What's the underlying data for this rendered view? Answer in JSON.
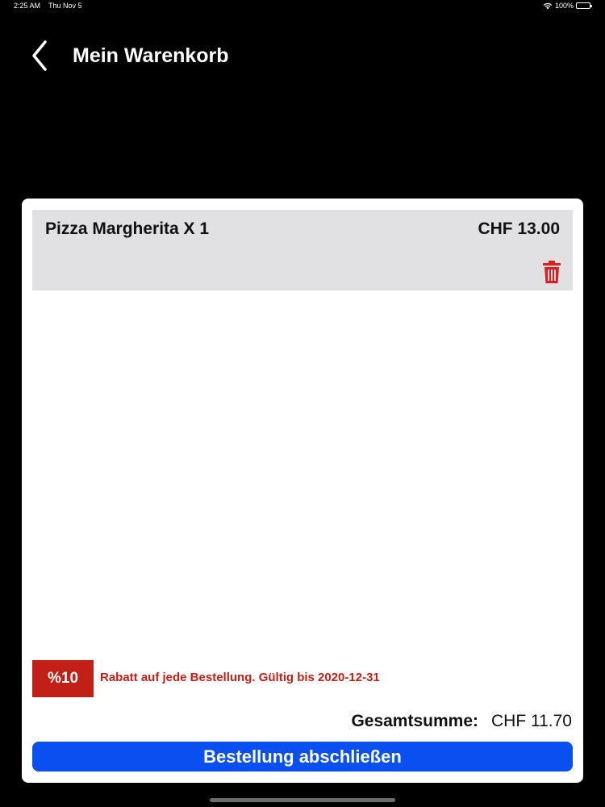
{
  "status_bar": {
    "time": "2:25 AM",
    "date": "Thu Nov 5",
    "battery": "100%"
  },
  "nav": {
    "title": "Mein Warenkorb",
    "back_icon": "chevron-left-icon"
  },
  "cart": {
    "items": [
      {
        "name": "Pizza Margherita X 1",
        "price": "CHF 13.00",
        "delete_icon": "trash-icon"
      }
    ],
    "discount": {
      "badge": "%10",
      "text": "Rabatt auf jede Bestellung. Gültig bis 2020-12-31"
    },
    "total": {
      "label": "Gesamtsumme:",
      "value": "CHF 11.70"
    },
    "checkout_label": "Bestellung abschließen"
  },
  "colors": {
    "background": "#000000",
    "card": "#ffffff",
    "item_bg": "#e1e1e3",
    "accent_red": "#c21f17",
    "button_blue": "#0a4ff0"
  }
}
